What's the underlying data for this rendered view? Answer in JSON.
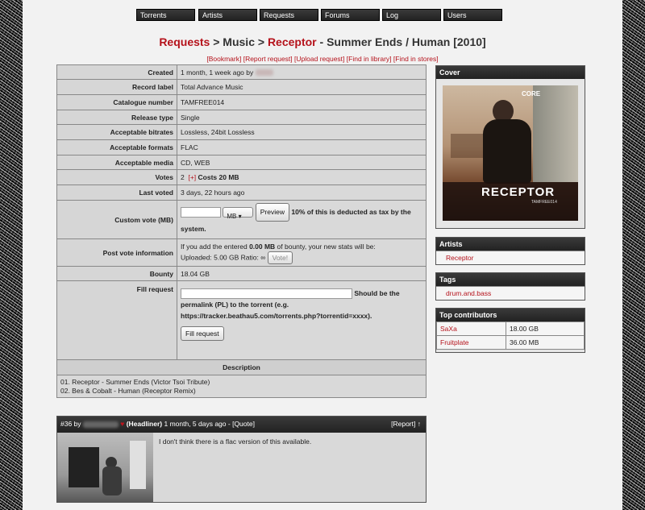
{
  "nav": [
    {
      "label": "Torrents"
    },
    {
      "label": "Artists"
    },
    {
      "label": "Requests"
    },
    {
      "label": "Forums"
    },
    {
      "label": "Log"
    },
    {
      "label": "Users"
    }
  ],
  "heading": {
    "requests": "Requests",
    "sep1": " > Music > ",
    "artist": "Receptor",
    "title": " - Summer Ends / Human [2010]"
  },
  "actions": {
    "bookmark": "Bookmark",
    "report": "Report request",
    "upload": "Upload request",
    "find_library": "Find in library",
    "find_stores": "Find in stores"
  },
  "details": {
    "created_label": "Created",
    "created_value": "1 month, 1 week ago by",
    "record_label_label": "Record label",
    "record_label_value": "Total Advance Music",
    "catalogue_label": "Catalogue number",
    "catalogue_value": "TAMFREE014",
    "release_type_label": "Release type",
    "release_type_value": "Single",
    "bitrates_label": "Acceptable bitrates",
    "bitrates_value": "Lossless, 24bit Lossless",
    "formats_label": "Acceptable formats",
    "formats_value": "FLAC",
    "media_label": "Acceptable media",
    "media_value": "CD, WEB",
    "votes_label": "Votes",
    "votes_count": "2",
    "votes_plus": "[+]",
    "votes_cost": "Costs 20 MB",
    "last_voted_label": "Last voted",
    "last_voted_value": "3 days, 22 hours ago",
    "custom_vote_label": "Custom vote (MB)",
    "custom_vote_unit": "MB",
    "preview_btn": "Preview",
    "tax_note": "10% of this is deducted as tax by the system.",
    "post_vote_label": "Post vote information",
    "post_vote_line1_a": "If you add the entered ",
    "post_vote_line1_b": "0.00 MB",
    "post_vote_line1_c": " of bounty, your new stats will be:",
    "post_vote_line2": "Uploaded: 5.00 GB Ratio: ∞",
    "vote_btn": "Vote!",
    "bounty_label": "Bounty",
    "bounty_value": "18.04 GB",
    "fill_label": "Fill request",
    "fill_note": "Should be the permalink (PL) to the torrent (e.g. https://tracker.beathau5.com/torrents.php?torrentid=xxxx).",
    "fill_btn": "Fill request",
    "description_label": "Description",
    "description_line1": "01. Receptor - Summer Ends (Victor Tsoi Tribute)",
    "description_line2": "02. Bes & Cobalt - Human (Receptor Remix)"
  },
  "sidebar": {
    "cover_title": "Cover",
    "cover_text": "RECEPTOR",
    "cover_subtext": "TAMFREE014",
    "cover_top": "CORE",
    "artists_title": "Artists",
    "artist": "Receptor",
    "tags_title": "Tags",
    "tag": "drum.and.bass",
    "contrib_title": "Top contributors",
    "contributors": [
      {
        "name": "SaXa",
        "amount": "18.00 GB"
      },
      {
        "name": "Fruitplate",
        "amount": "36.00 MB"
      }
    ]
  },
  "comment": {
    "id": "#36 by",
    "rank": "(Headliner)",
    "time": "1 month, 5 days ago",
    "quote": "[Quote]",
    "report": "[Report]",
    "up": "↑",
    "text": "I don't think there is a flac version of this available."
  },
  "colors": {
    "accent": "#b5121b",
    "header_bar": "#2b2b2b",
    "table_bg": "#d6d6d6"
  }
}
